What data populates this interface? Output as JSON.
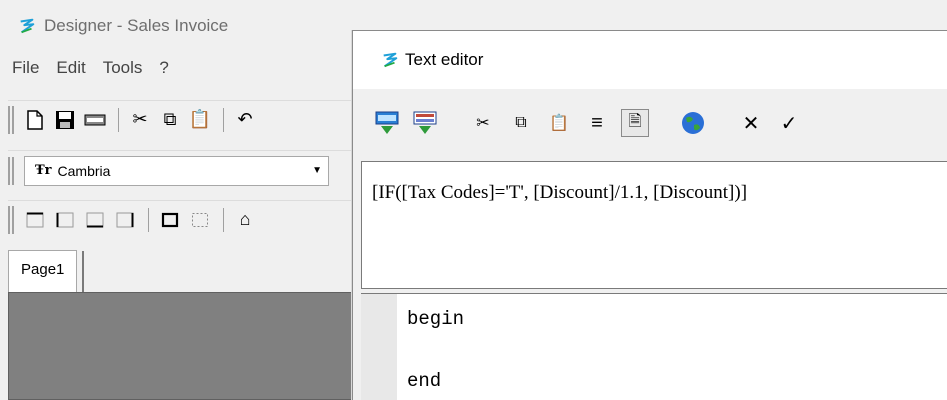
{
  "designer": {
    "title": "Designer - Sales Invoice",
    "menu": [
      "File",
      "Edit",
      "Tools",
      "?"
    ],
    "font_name": "Cambria",
    "page_tab": "Page1"
  },
  "editor": {
    "title": "Text editor",
    "expression": "[IF([Tax Codes]='T', [Discount]/1.1, [Discount])]",
    "code_lines": [
      "begin",
      "end"
    ]
  }
}
